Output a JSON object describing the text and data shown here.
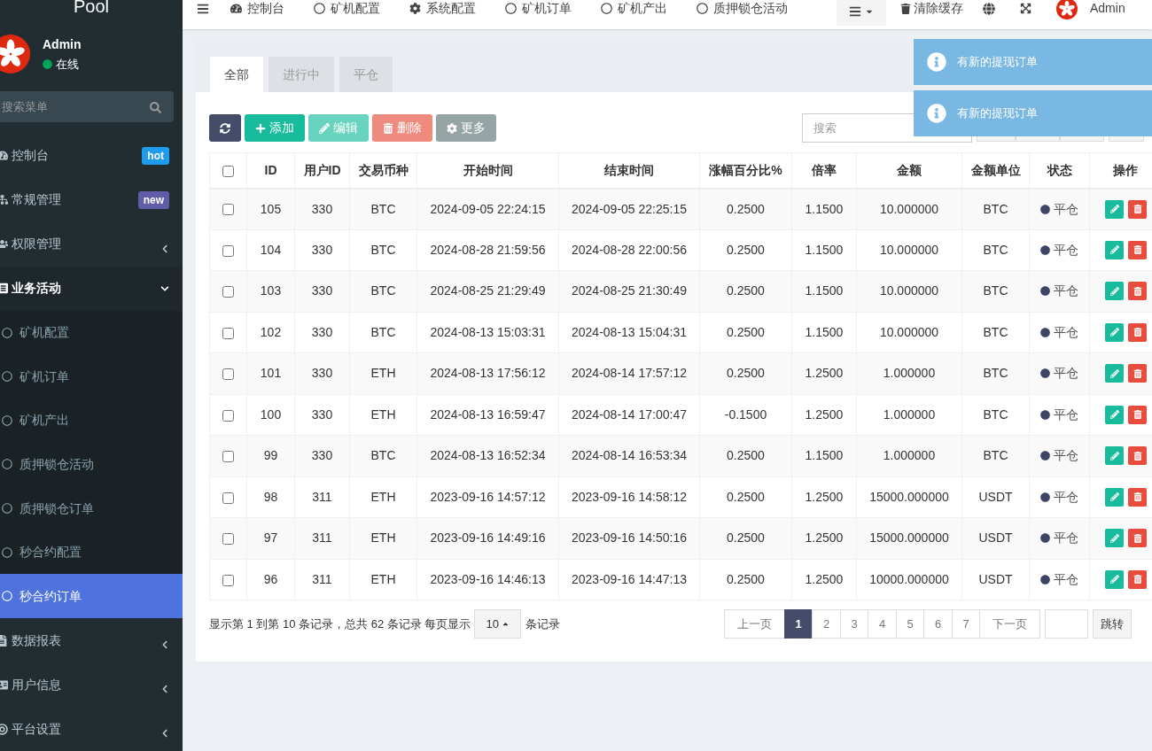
{
  "sidebar": {
    "logo": "Pool",
    "user": {
      "name": "Admin",
      "status": "在线"
    },
    "search": {
      "placeholder": "搜索菜单"
    },
    "items": [
      {
        "kind": "dashboard",
        "label": "控制台",
        "badge": {
          "text": "hot",
          "color": "#1f9cee"
        }
      },
      {
        "kind": "sitemap",
        "label": "常规管理",
        "badge": {
          "text": "new",
          "color": "#605ca8"
        }
      },
      {
        "kind": "users",
        "label": "权限管理",
        "expanded": false
      },
      {
        "kind": "list",
        "label": "业务活动",
        "expanded": true,
        "children": [
          {
            "label": "矿机配置",
            "selected": false
          },
          {
            "label": "矿机订单",
            "selected": false
          },
          {
            "label": "矿机产出",
            "selected": false
          },
          {
            "label": "质押锁仓活动",
            "selected": false
          },
          {
            "label": "质押锁仓订单",
            "selected": false
          },
          {
            "label": "秒合约配置",
            "selected": false
          },
          {
            "label": "秒合约订单",
            "selected": true
          }
        ]
      },
      {
        "kind": "file",
        "label": "数据报表",
        "expanded": false
      },
      {
        "kind": "card",
        "label": "用户信息",
        "expanded": false
      },
      {
        "kind": "target",
        "label": "平台设置",
        "expanded": false
      }
    ]
  },
  "topbar": {
    "nav": [
      {
        "kind": "dashboard",
        "label": "控制台"
      },
      {
        "kind": "circle",
        "label": "矿机配置"
      },
      {
        "kind": "gear",
        "label": "系统配置"
      },
      {
        "kind": "circle",
        "label": "矿机订单"
      },
      {
        "kind": "circle",
        "label": "矿机产出"
      },
      {
        "kind": "circle",
        "label": "质押锁仓活动"
      }
    ],
    "clear_cache": "清除缓存",
    "user": "Admin"
  },
  "notifications": [
    "有新的提现订单",
    "有新的提现订单"
  ],
  "tabs": [
    {
      "label": "全部",
      "selected": true
    },
    {
      "label": "进行中",
      "selected": false
    },
    {
      "label": "平仓",
      "selected": false
    }
  ],
  "toolbar": {
    "buttons": [
      {
        "kind": "refresh",
        "disabled": false
      },
      {
        "kind": "add",
        "label": "添加",
        "disabled": false
      },
      {
        "kind": "edit",
        "label": "编辑",
        "disabled": true
      },
      {
        "kind": "delete",
        "label": "删除",
        "disabled": true
      },
      {
        "kind": "more",
        "label": "更多",
        "disabled": false
      }
    ],
    "search": {
      "placeholder": "搜索"
    }
  },
  "table": {
    "columns": [
      "ID",
      "用户ID",
      "交易币种",
      "开始时间",
      "结束时间",
      "涨幅百分比%",
      "倍率",
      "金额",
      "金额单位",
      "状态",
      "操作"
    ],
    "all_checked": false,
    "rows": [
      {
        "checked": false,
        "cells": [
          "105",
          "330",
          "BTC",
          "2024-09-05 22:24:15",
          "2024-09-05 22:25:15",
          "0.2500",
          "1.1500",
          "10.000000",
          "BTC"
        ],
        "status": "平仓"
      },
      {
        "checked": false,
        "cells": [
          "104",
          "330",
          "BTC",
          "2024-08-28 21:59:56",
          "2024-08-28 22:00:56",
          "0.2500",
          "1.1500",
          "10.000000",
          "BTC"
        ],
        "status": "平仓"
      },
      {
        "checked": false,
        "cells": [
          "103",
          "330",
          "BTC",
          "2024-08-25 21:29:49",
          "2024-08-25 21:30:49",
          "0.2500",
          "1.1500",
          "10.000000",
          "BTC"
        ],
        "status": "平仓"
      },
      {
        "checked": false,
        "cells": [
          "102",
          "330",
          "BTC",
          "2024-08-13 15:03:31",
          "2024-08-13 15:04:31",
          "0.2500",
          "1.1500",
          "10.000000",
          "BTC"
        ],
        "status": "平仓"
      },
      {
        "checked": false,
        "cells": [
          "101",
          "330",
          "ETH",
          "2024-08-13 17:56:12",
          "2024-08-14 17:57:12",
          "0.2500",
          "1.2500",
          "1.000000",
          "BTC"
        ],
        "status": "平仓"
      },
      {
        "checked": false,
        "cells": [
          "100",
          "330",
          "ETH",
          "2024-08-13 16:59:47",
          "2024-08-14 17:00:47",
          "-0.1500",
          "1.2500",
          "1.000000",
          "BTC"
        ],
        "status": "平仓"
      },
      {
        "checked": false,
        "cells": [
          "99",
          "330",
          "BTC",
          "2024-08-13 16:52:34",
          "2024-08-14 16:53:34",
          "0.2500",
          "1.1500",
          "1.000000",
          "BTC"
        ],
        "status": "平仓"
      },
      {
        "checked": false,
        "cells": [
          "98",
          "311",
          "ETH",
          "2023-09-16 14:57:12",
          "2023-09-16 14:58:12",
          "0.2500",
          "1.2500",
          "15000.000000",
          "USDT"
        ],
        "status": "平仓"
      },
      {
        "checked": false,
        "cells": [
          "97",
          "311",
          "ETH",
          "2023-09-16 14:49:16",
          "2023-09-16 14:50:16",
          "0.2500",
          "1.2500",
          "15000.000000",
          "USDT"
        ],
        "status": "平仓"
      },
      {
        "checked": false,
        "cells": [
          "96",
          "311",
          "ETH",
          "2023-09-16 14:46:13",
          "2023-09-16 14:47:13",
          "0.2500",
          "1.2500",
          "10000.000000",
          "USDT"
        ],
        "status": "平仓"
      }
    ]
  },
  "pagination": {
    "summary": "显示第 1 到第 10 条记录，总共 62 条记录 每页显示",
    "page_size": "10",
    "suffix": "条记录",
    "prev": "上一页",
    "pages": [
      {
        "label": "1",
        "selected": true
      },
      {
        "label": "2",
        "selected": false
      },
      {
        "label": "3",
        "selected": false
      },
      {
        "label": "4",
        "selected": false
      },
      {
        "label": "5",
        "selected": false
      },
      {
        "label": "6",
        "selected": false
      },
      {
        "label": "7",
        "selected": false
      }
    ],
    "next": "下一页",
    "jump": "跳转"
  }
}
